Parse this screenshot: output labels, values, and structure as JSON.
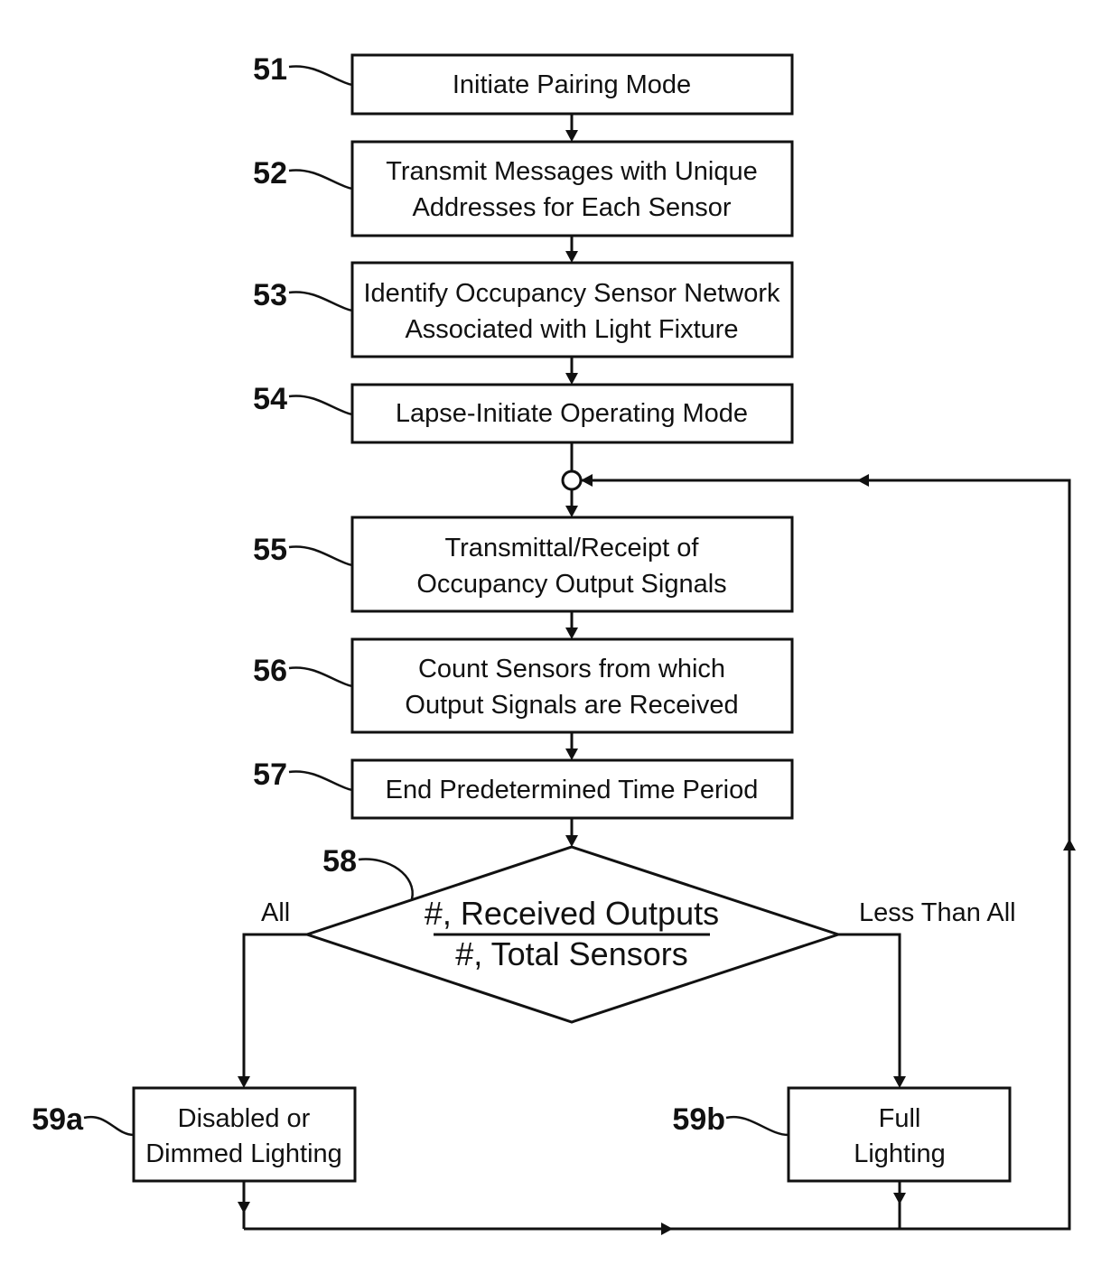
{
  "diagram": {
    "type": "flowchart",
    "steps": [
      {
        "ref": "51",
        "lines": [
          "Initiate Pairing Mode"
        ]
      },
      {
        "ref": "52",
        "lines": [
          "Transmit Messages with Unique",
          "Addresses for Each Sensor"
        ]
      },
      {
        "ref": "53",
        "lines": [
          "Identify Occupancy Sensor Network",
          "Associated with Light Fixture"
        ]
      },
      {
        "ref": "54",
        "lines": [
          "Lapse-Initiate Operating Mode"
        ]
      },
      {
        "ref": "55",
        "lines": [
          "Transmittal/Receipt of",
          "Occupancy Output Signals"
        ]
      },
      {
        "ref": "56",
        "lines": [
          "Count Sensors from which",
          "Output Signals are Received"
        ]
      },
      {
        "ref": "57",
        "lines": [
          "End Predetermined Time Period"
        ]
      }
    ],
    "decision": {
      "ref": "58",
      "numerator": "#, Received Outputs",
      "denominator": "#, Total Sensors",
      "left_branch_label": "All",
      "right_branch_label": "Less Than All"
    },
    "outcomes": [
      {
        "ref": "59a",
        "lines": [
          "Disabled or",
          "Dimmed Lighting"
        ]
      },
      {
        "ref": "59b",
        "lines": [
          "Full",
          "Lighting"
        ]
      }
    ],
    "loop": {
      "from": [
        "59a",
        "59b"
      ],
      "to": "junction-before-55"
    }
  }
}
